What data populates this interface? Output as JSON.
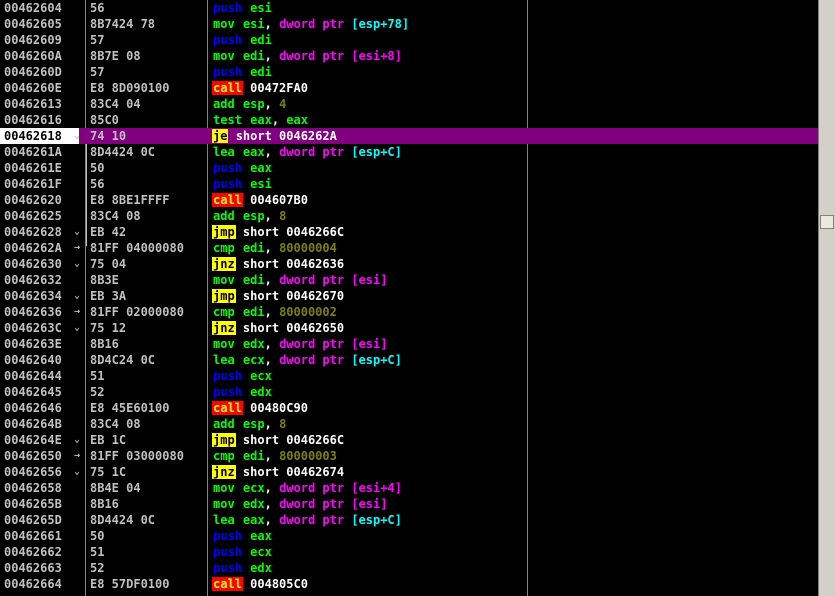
{
  "rows": [
    {
      "addr": "00462604",
      "hex": "56",
      "mnem": "push",
      "cls": "m-push",
      "ops": [
        {
          "t": "esi",
          "c": "reg"
        }
      ]
    },
    {
      "addr": "00462605",
      "hex": "8B7424 78",
      "mnem": "mov",
      "cls": "m-mov",
      "ops": [
        {
          "t": "esi",
          "c": "reg"
        },
        {
          "t": ", ",
          "c": "txt"
        },
        {
          "t": "dword ptr ",
          "c": "kw"
        },
        {
          "t": "[esp+78]",
          "c": "br"
        }
      ]
    },
    {
      "addr": "00462609",
      "hex": "57",
      "mnem": "push",
      "cls": "m-push",
      "ops": [
        {
          "t": "edi",
          "c": "reg"
        }
      ]
    },
    {
      "addr": "0046260A",
      "hex": "8B7E 08",
      "mnem": "mov",
      "cls": "m-mov",
      "ops": [
        {
          "t": "edi",
          "c": "reg"
        },
        {
          "t": ", ",
          "c": "txt"
        },
        {
          "t": "dword ptr ",
          "c": "kw"
        },
        {
          "t": "[esi+8]",
          "c": "kw"
        }
      ]
    },
    {
      "addr": "0046260D",
      "hex": "57",
      "mnem": "push",
      "cls": "m-push",
      "ops": [
        {
          "t": "edi",
          "c": "reg"
        }
      ]
    },
    {
      "addr": "0046260E",
      "hex": "E8 8D090100",
      "mnem": "call",
      "cls": "m-call",
      "ops": [
        {
          "t": "00472FA0",
          "c": "tgt"
        }
      ]
    },
    {
      "addr": "00462613",
      "hex": "83C4 04",
      "mnem": "add",
      "cls": "m-add",
      "ops": [
        {
          "t": "esp",
          "c": "reg"
        },
        {
          "t": ", ",
          "c": "txt"
        },
        {
          "t": "4",
          "c": "num"
        }
      ]
    },
    {
      "addr": "00462616",
      "hex": "85C0",
      "mnem": "test",
      "cls": "m-test",
      "ops": [
        {
          "t": "eax",
          "c": "reg"
        },
        {
          "t": ", ",
          "c": "txt"
        },
        {
          "t": "eax",
          "c": "reg"
        }
      ]
    },
    {
      "addr": "00462618",
      "hex": "74 10",
      "mnem": "je",
      "cls": "m-jmp",
      "ops": [
        {
          "t": "short 0046262A",
          "c": "tgt"
        }
      ],
      "selected": true,
      "mark": "v"
    },
    {
      "addr": "0046261A",
      "hex": "8D4424 0C",
      "mnem": "lea",
      "cls": "m-lea",
      "ops": [
        {
          "t": "eax",
          "c": "reg"
        },
        {
          "t": ", ",
          "c": "txt"
        },
        {
          "t": "dword ptr ",
          "c": "kw"
        },
        {
          "t": "[esp+C]",
          "c": "br"
        }
      ]
    },
    {
      "addr": "0046261E",
      "hex": "50",
      "mnem": "push",
      "cls": "m-push",
      "ops": [
        {
          "t": "eax",
          "c": "reg"
        }
      ]
    },
    {
      "addr": "0046261F",
      "hex": "56",
      "mnem": "push",
      "cls": "m-push",
      "ops": [
        {
          "t": "esi",
          "c": "reg"
        }
      ]
    },
    {
      "addr": "00462620",
      "hex": "E8 8BE1FFFF",
      "mnem": "call",
      "cls": "m-call",
      "ops": [
        {
          "t": "004607B0",
          "c": "tgt"
        }
      ]
    },
    {
      "addr": "00462625",
      "hex": "83C4 08",
      "mnem": "add",
      "cls": "m-add",
      "ops": [
        {
          "t": "esp",
          "c": "reg"
        },
        {
          "t": ", ",
          "c": "txt"
        },
        {
          "t": "8",
          "c": "num"
        }
      ]
    },
    {
      "addr": "00462628",
      "hex": "EB 42",
      "mnem": "jmp",
      "cls": "m-jmp",
      "ops": [
        {
          "t": "short 0046266C",
          "c": "tgt"
        }
      ],
      "mark": "v"
    },
    {
      "addr": "0046262A",
      "hex": "81FF 04000080",
      "mnem": "cmp",
      "cls": "m-cmp",
      "ops": [
        {
          "t": "edi",
          "c": "reg"
        },
        {
          "t": ", ",
          "c": "txt"
        },
        {
          "t": "80000004",
          "c": "num"
        }
      ],
      "mark": ">"
    },
    {
      "addr": "00462630",
      "hex": "75 04",
      "mnem": "jnz",
      "cls": "m-jmp",
      "ops": [
        {
          "t": "short 00462636",
          "c": "tgt"
        }
      ],
      "mark": "v"
    },
    {
      "addr": "00462632",
      "hex": "8B3E",
      "mnem": "mov",
      "cls": "m-mov",
      "ops": [
        {
          "t": "edi",
          "c": "reg"
        },
        {
          "t": ", ",
          "c": "txt"
        },
        {
          "t": "dword ptr ",
          "c": "kw"
        },
        {
          "t": "[esi]",
          "c": "kw"
        }
      ]
    },
    {
      "addr": "00462634",
      "hex": "EB 3A",
      "mnem": "jmp",
      "cls": "m-jmp",
      "ops": [
        {
          "t": "short 00462670",
          "c": "tgt"
        }
      ],
      "mark": "v"
    },
    {
      "addr": "00462636",
      "hex": "81FF 02000080",
      "mnem": "cmp",
      "cls": "m-cmp",
      "ops": [
        {
          "t": "edi",
          "c": "reg"
        },
        {
          "t": ", ",
          "c": "txt"
        },
        {
          "t": "80000002",
          "c": "num"
        }
      ],
      "mark": ">"
    },
    {
      "addr": "0046263C",
      "hex": "75 12",
      "mnem": "jnz",
      "cls": "m-jmp",
      "ops": [
        {
          "t": "short 00462650",
          "c": "tgt"
        }
      ],
      "mark": "v"
    },
    {
      "addr": "0046263E",
      "hex": "8B16",
      "mnem": "mov",
      "cls": "m-mov",
      "ops": [
        {
          "t": "edx",
          "c": "reg"
        },
        {
          "t": ", ",
          "c": "txt"
        },
        {
          "t": "dword ptr ",
          "c": "kw"
        },
        {
          "t": "[esi]",
          "c": "kw"
        }
      ]
    },
    {
      "addr": "00462640",
      "hex": "8D4C24 0C",
      "mnem": "lea",
      "cls": "m-lea",
      "ops": [
        {
          "t": "ecx",
          "c": "reg"
        },
        {
          "t": ", ",
          "c": "txt"
        },
        {
          "t": "dword ptr ",
          "c": "kw"
        },
        {
          "t": "[esp+C]",
          "c": "br"
        }
      ]
    },
    {
      "addr": "00462644",
      "hex": "51",
      "mnem": "push",
      "cls": "m-push",
      "ops": [
        {
          "t": "ecx",
          "c": "reg"
        }
      ]
    },
    {
      "addr": "00462645",
      "hex": "52",
      "mnem": "push",
      "cls": "m-push",
      "ops": [
        {
          "t": "edx",
          "c": "reg"
        }
      ]
    },
    {
      "addr": "00462646",
      "hex": "E8 45E60100",
      "mnem": "call",
      "cls": "m-call",
      "ops": [
        {
          "t": "00480C90",
          "c": "tgt"
        }
      ]
    },
    {
      "addr": "0046264B",
      "hex": "83C4 08",
      "mnem": "add",
      "cls": "m-add",
      "ops": [
        {
          "t": "esp",
          "c": "reg"
        },
        {
          "t": ", ",
          "c": "txt"
        },
        {
          "t": "8",
          "c": "num"
        }
      ]
    },
    {
      "addr": "0046264E",
      "hex": "EB 1C",
      "mnem": "jmp",
      "cls": "m-jmp",
      "ops": [
        {
          "t": "short 0046266C",
          "c": "tgt"
        }
      ],
      "mark": "v"
    },
    {
      "addr": "00462650",
      "hex": "81FF 03000080",
      "mnem": "cmp",
      "cls": "m-cmp",
      "ops": [
        {
          "t": "edi",
          "c": "reg"
        },
        {
          "t": ", ",
          "c": "txt"
        },
        {
          "t": "80000003",
          "c": "num"
        }
      ],
      "mark": ">"
    },
    {
      "addr": "00462656",
      "hex": "75 1C",
      "mnem": "jnz",
      "cls": "m-jmp",
      "ops": [
        {
          "t": "short 00462674",
          "c": "tgt"
        }
      ],
      "mark": "v"
    },
    {
      "addr": "00462658",
      "hex": "8B4E 04",
      "mnem": "mov",
      "cls": "m-mov",
      "ops": [
        {
          "t": "ecx",
          "c": "reg"
        },
        {
          "t": ", ",
          "c": "txt"
        },
        {
          "t": "dword ptr ",
          "c": "kw"
        },
        {
          "t": "[esi+4]",
          "c": "kw"
        }
      ]
    },
    {
      "addr": "0046265B",
      "hex": "8B16",
      "mnem": "mov",
      "cls": "m-mov",
      "ops": [
        {
          "t": "edx",
          "c": "reg"
        },
        {
          "t": ", ",
          "c": "txt"
        },
        {
          "t": "dword ptr ",
          "c": "kw"
        },
        {
          "t": "[esi]",
          "c": "kw"
        }
      ]
    },
    {
      "addr": "0046265D",
      "hex": "8D4424 0C",
      "mnem": "lea",
      "cls": "m-lea",
      "ops": [
        {
          "t": "eax",
          "c": "reg"
        },
        {
          "t": ", ",
          "c": "txt"
        },
        {
          "t": "dword ptr ",
          "c": "kw"
        },
        {
          "t": "[esp+C]",
          "c": "br"
        }
      ]
    },
    {
      "addr": "00462661",
      "hex": "50",
      "mnem": "push",
      "cls": "m-push",
      "ops": [
        {
          "t": "eax",
          "c": "reg"
        }
      ]
    },
    {
      "addr": "00462662",
      "hex": "51",
      "mnem": "push",
      "cls": "m-push",
      "ops": [
        {
          "t": "ecx",
          "c": "reg"
        }
      ]
    },
    {
      "addr": "00462663",
      "hex": "52",
      "mnem": "push",
      "cls": "m-push",
      "ops": [
        {
          "t": "edx",
          "c": "reg"
        }
      ]
    },
    {
      "addr": "00462664",
      "hex": "E8 57DF0100",
      "mnem": "call",
      "cls": "m-call",
      "ops": [
        {
          "t": "004805C0",
          "c": "tgt"
        }
      ]
    }
  ]
}
